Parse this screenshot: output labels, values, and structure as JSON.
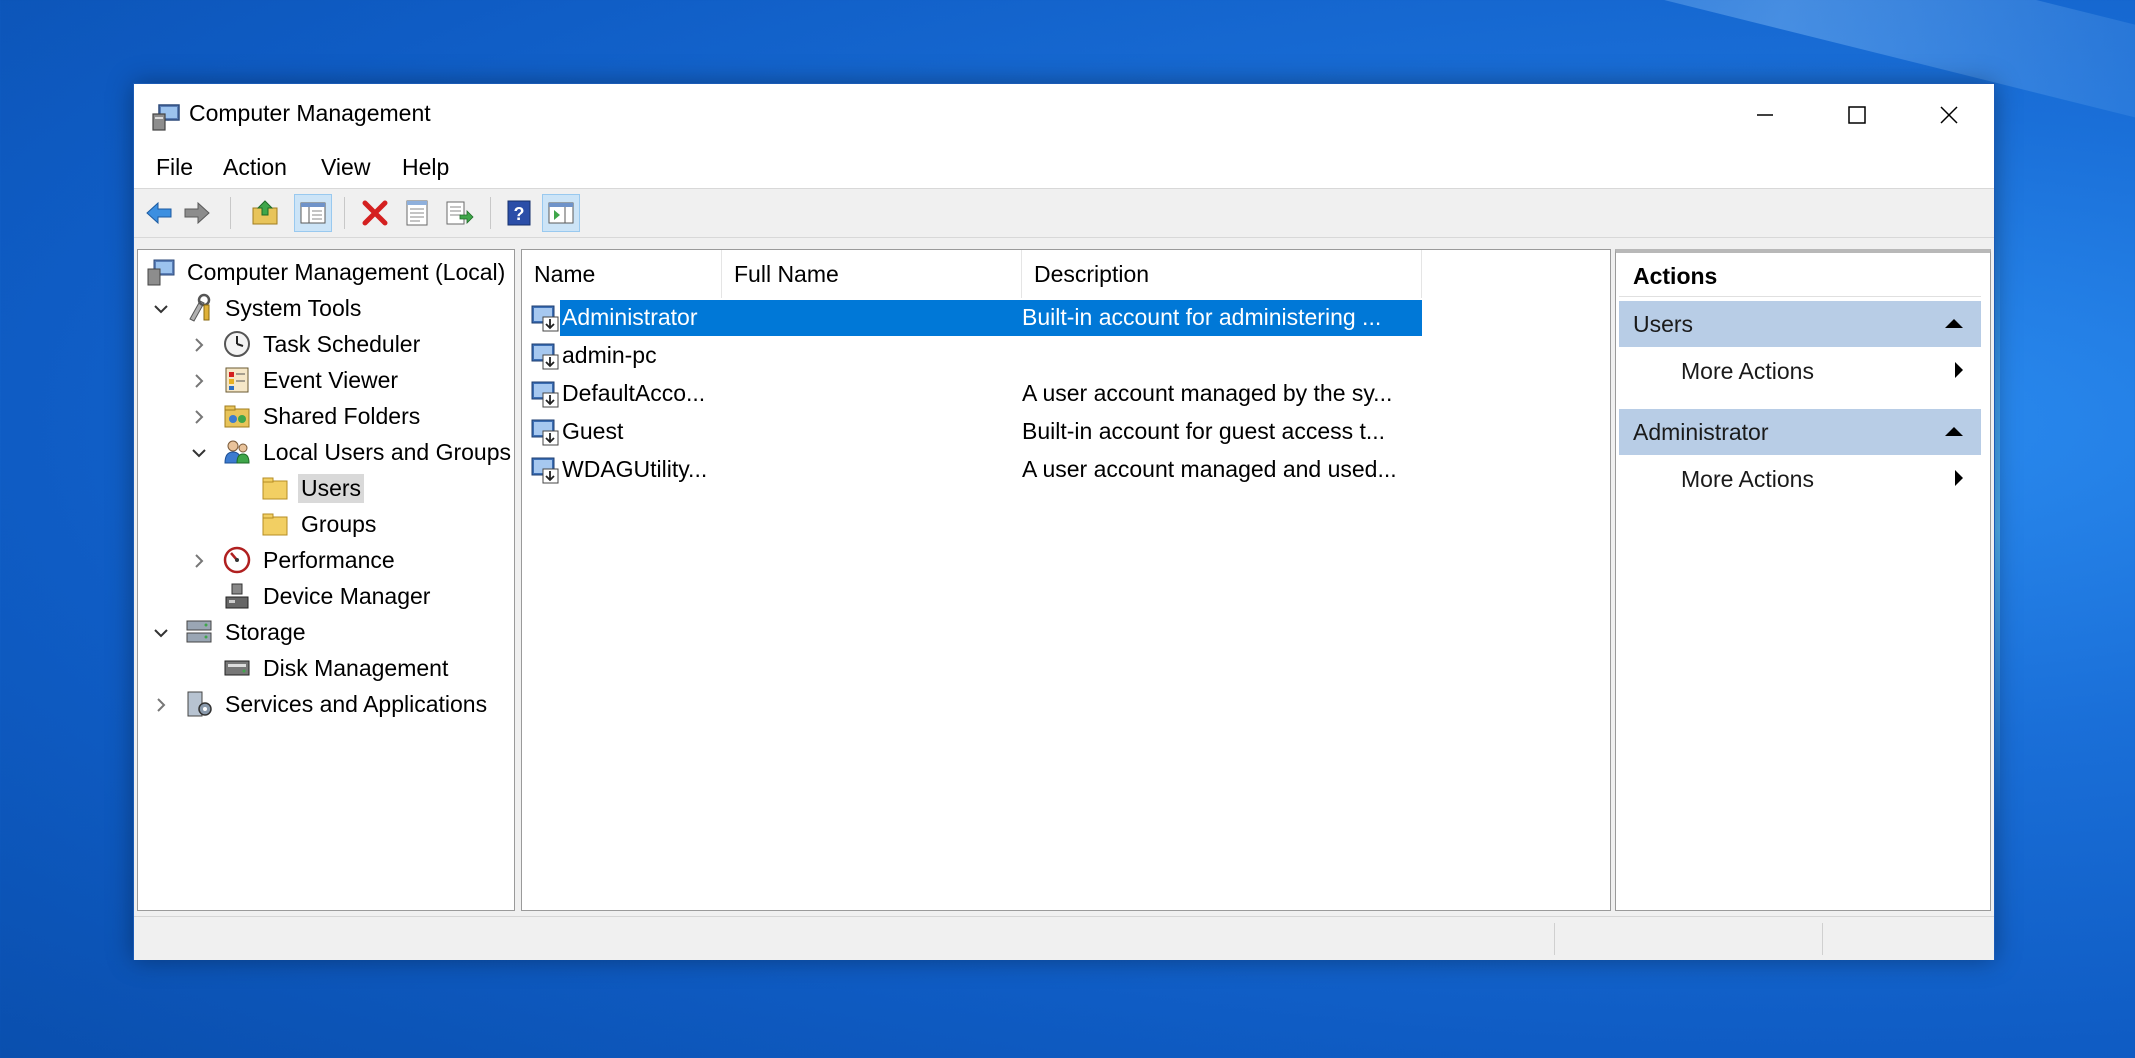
{
  "window": {
    "title": "Computer Management"
  },
  "menu": [
    "File",
    "Action",
    "View",
    "Help"
  ],
  "toolbar": [
    "back-icon",
    "forward-icon",
    "up-folder-icon",
    "show-hide-tree-icon",
    "delete-icon",
    "properties-icon",
    "export-list-icon",
    "help-icon",
    "show-hide-action-pane-icon"
  ],
  "tree": {
    "root": "Computer Management (Local)",
    "system_tools": "System Tools",
    "task_scheduler": "Task Scheduler",
    "event_viewer": "Event Viewer",
    "shared_folders": "Shared Folders",
    "local_users_groups": "Local Users and Groups",
    "users": "Users",
    "groups": "Groups",
    "performance": "Performance",
    "device_manager": "Device Manager",
    "storage": "Storage",
    "disk_management": "Disk Management",
    "services_apps": "Services and Applications"
  },
  "list": {
    "columns": [
      "Name",
      "Full Name",
      "Description"
    ],
    "rows": [
      {
        "name": "Administrator",
        "full_name": "",
        "description": "Built-in account for administering ..."
      },
      {
        "name": "admin-pc",
        "full_name": "",
        "description": ""
      },
      {
        "name": "DefaultAcco...",
        "full_name": "",
        "description": "A user account managed by the sy..."
      },
      {
        "name": "Guest",
        "full_name": "",
        "description": "Built-in account for guest access t..."
      },
      {
        "name": "WDAGUtility...",
        "full_name": "",
        "description": "A user account managed and used..."
      }
    ]
  },
  "actions": {
    "title": "Actions",
    "group1": "Users",
    "group1_item": "More Actions",
    "group2": "Administrator",
    "group2_item": "More Actions"
  }
}
